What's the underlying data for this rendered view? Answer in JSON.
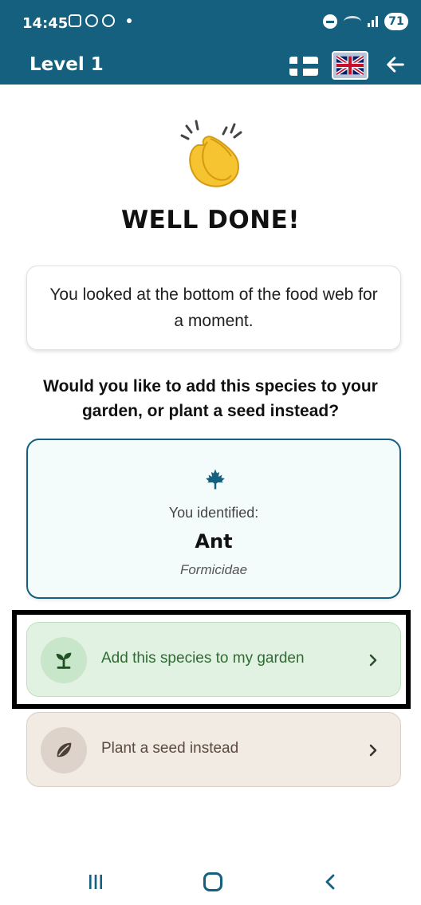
{
  "status_bar": {
    "time": "14:45",
    "battery": "71",
    "icons": [
      "screenshot-icon",
      "whatsapp-icon",
      "alarm-icon",
      "notification-dot",
      "dnd-icon",
      "wifi-icon",
      "signal-icon",
      "battery-icon"
    ]
  },
  "app_bar": {
    "title": "Level 1",
    "languages": [
      "finnish-flag",
      "uk-flag"
    ],
    "selected_language": "uk-flag"
  },
  "main": {
    "emoji": "clapping-hands-icon",
    "headline": "WELL DONE!",
    "message": "You looked at the bottom of the food web for a moment.",
    "question": "Would you like to add this species to your garden, or plant a seed instead?"
  },
  "identification": {
    "icon": "maple-leaf-icon",
    "label": "You identified:",
    "common_name": "Ant",
    "scientific_name": "Formicidae"
  },
  "options": {
    "add_species": {
      "label": "Add this species to my garden",
      "icon": "sprout-icon"
    },
    "plant_seed": {
      "label": "Plant a seed instead",
      "icon": "seed-icon"
    }
  },
  "colors": {
    "primary": "#14607e",
    "add_option_bg": "#e2f2e2",
    "seed_option_bg": "#f1ebe4",
    "card_border": "#14607e"
  },
  "nav_bar": {
    "icons": [
      "recent-apps-icon",
      "home-icon",
      "back-icon"
    ]
  }
}
